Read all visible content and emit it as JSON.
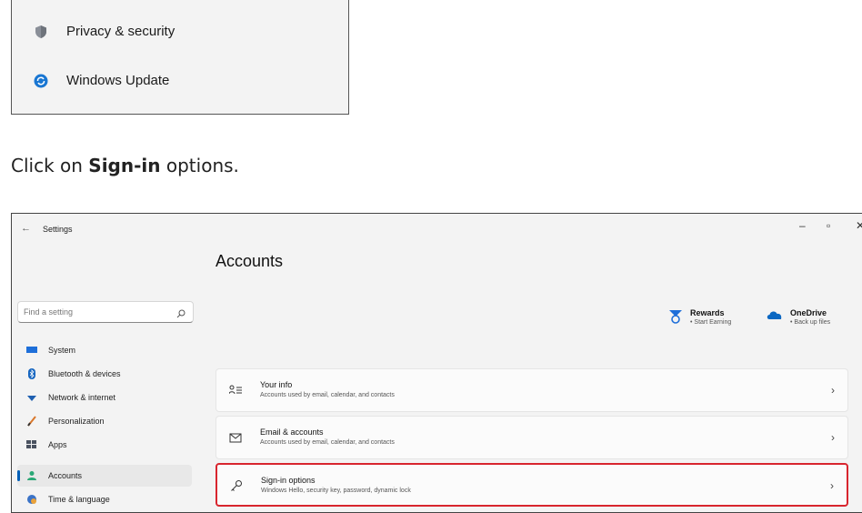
{
  "top_menu": {
    "items": [
      {
        "label": "Privacy & security",
        "icon": "shield-icon"
      },
      {
        "label": "Windows Update",
        "icon": "windows-update-icon"
      }
    ]
  },
  "instruction": {
    "prefix": "Click on ",
    "bold": "Sign-in",
    "suffix": " options."
  },
  "window": {
    "back_glyph": "←",
    "title": "Settings",
    "minimize": "–",
    "restore": "▫",
    "close": "✕",
    "page_title": "Accounts",
    "search_placeholder": "Find a setting",
    "nav": [
      {
        "label": "System",
        "icon": "monitor-icon",
        "selected": false
      },
      {
        "label": "Bluetooth & devices",
        "icon": "bluetooth-icon",
        "selected": false
      },
      {
        "label": "Network & internet",
        "icon": "wifi-icon",
        "selected": false
      },
      {
        "label": "Personalization",
        "icon": "brush-icon",
        "selected": false
      },
      {
        "label": "Apps",
        "icon": "apps-icon",
        "selected": false
      },
      {
        "label": "Accounts",
        "icon": "person-icon",
        "selected": true
      },
      {
        "label": "Time & language",
        "icon": "globe-clock-icon",
        "selected": false
      }
    ],
    "promos": [
      {
        "title": "Rewards",
        "sub": "• Start Earning",
        "icon": "rewards-icon"
      },
      {
        "title": "OneDrive",
        "sub": "• Back up files",
        "icon": "cloud-icon"
      }
    ],
    "cards": [
      {
        "title": "Your info",
        "sub": "Accounts used by email, calendar, and contacts",
        "icon": "id-card-icon"
      },
      {
        "title": "Email & accounts",
        "sub": "Accounts used by email, calendar, and contacts",
        "icon": "mail-icon"
      },
      {
        "title": "Sign-in options",
        "sub": "Windows Hello, security key, password, dynamic lock",
        "icon": "key-icon"
      }
    ],
    "chevron": "›"
  },
  "colors": {
    "accent": "#005fb8",
    "highlight_border": "#d8252e"
  }
}
